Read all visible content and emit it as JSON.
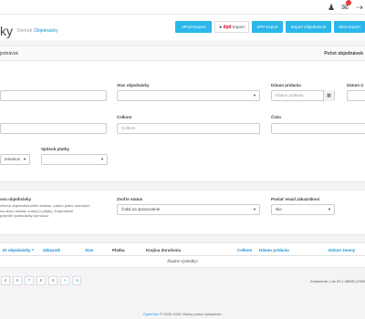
{
  "topbar": {
    "icons": [
      "user-icon",
      "gift-icon",
      "exit-icon"
    ],
    "colors": {
      "accent": "#2ab7ea",
      "alert": "#e23b3b",
      "link": "#1e91cf"
    }
  },
  "header": {
    "title": "ky",
    "breadcrumb": [
      "Domov",
      "Objednávky"
    ],
    "buttons": [
      "UPost Export",
      "Export",
      "ePH Export",
      "Export Objednávok",
      "SEO Export"
    ],
    "dpd_logo": "dpd"
  },
  "list": {
    "title": "jednávok",
    "count_label": "Počet objednávok"
  },
  "filters": {
    "stav_label": "Stav objednávky",
    "datum_pridania_label": "Dátum pridania",
    "datum_pridania_placeholder": "Dátum pridania",
    "datum_zmeny_label": "Dátum ú",
    "celkom_label": "Celkom",
    "celkom_placeholder": "Celkom",
    "cislo_label": "Číslo",
    "sposob_platby_label": "Spôsob platby",
    "small_select_value": "Ienenios"
  },
  "bulk": {
    "stav_label": "ovu objednávky",
    "help_text": [
      "zmenu objednávkového statusu, potom jedno viacerých",
      "na nemu mesiac zmeny k platby, Zneprídenie",
      "potvrďte požiadavky pomocou"
    ],
    "zvolte_status_label": "Zvoľte status",
    "zvolte_status_value": "Čaká na spracovanie",
    "poslat_email_label": "Poslať email zákazníkovi",
    "poslat_email_value": "Nie"
  },
  "table": {
    "headers": [
      "ID objednávky",
      "Zákazník",
      "Stav",
      "Platba",
      "Krajina doručenia",
      "Celkom",
      "Dátum pridania",
      "Dátum zmeny"
    ],
    "sort_arrow": "^",
    "empty_text": "Žiadne výsledky!"
  },
  "pager": {
    "pages": [
      "5",
      "6",
      "7",
      "8",
      "9",
      ">",
      ">|"
    ],
    "info": "Zobrazené 1 až 20 z 38995 (1950"
  },
  "footer": {
    "brand": "OpenCart",
    "text": " © 2009-2020 Všetky práva vyhradené."
  }
}
